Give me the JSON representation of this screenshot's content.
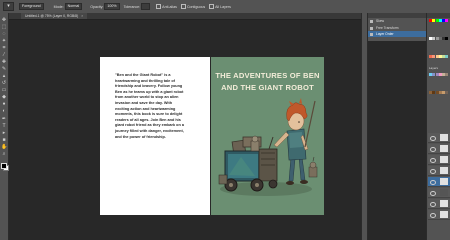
{
  "options_bar": {
    "preset_value": "Foreground",
    "mode_label": "Mode:",
    "mode_value": "Normal",
    "opacity_label": "Opacity:",
    "opacity_value": "100%",
    "tolerance_label": "Tolerance:",
    "anti_alias_label": "Anti-alias",
    "contiguous_label": "Contiguous",
    "all_layers_label": "All Layers"
  },
  "document_tab": {
    "title": "Untitled-1 @ 75% (Layer 0, RGB/8)",
    "close_glyph": "×"
  },
  "history_panel": {
    "items": [
      {
        "label": "Skew",
        "active": false
      },
      {
        "label": "Free Transform",
        "active": false
      },
      {
        "label": "Layer Order",
        "active": true
      }
    ]
  },
  "layers_panel": {
    "label": "Layers"
  },
  "document": {
    "blurb": "\"Ben and the Giant Robot\" is a heartwarming and thrilling tale of friendship and bravery. Follow young Ben as he teams up with a giant robot from another world to stop an alien invasion and save the day. With exciting action and heartwarming moments, this book is sure to delight readers of all ages. Join Ben and his giant robot friend as they embark on a journey filled with danger, excitement, and the power of friendship.",
    "cover_title_line1": "THE ADVENTURES OF BEN",
    "cover_title_line2": "AND THE GIANT ROBOT"
  },
  "colors": {
    "app_bg": "#282828",
    "panel_bg": "#535353",
    "cover_green": "#6b8f72",
    "selection_blue": "#3d6d9e"
  },
  "icons": {
    "tools": [
      "move-icon",
      "marquee-icon",
      "lasso-icon",
      "magic-wand-icon",
      "crop-icon",
      "eyedropper-icon",
      "healing-icon",
      "brush-icon",
      "stamp-icon",
      "history-brush-icon",
      "eraser-icon",
      "paint-bucket-icon",
      "blur-icon",
      "dodge-icon",
      "pen-icon",
      "type-icon",
      "path-select-icon",
      "shape-icon",
      "hand-icon",
      "zoom-icon"
    ]
  }
}
